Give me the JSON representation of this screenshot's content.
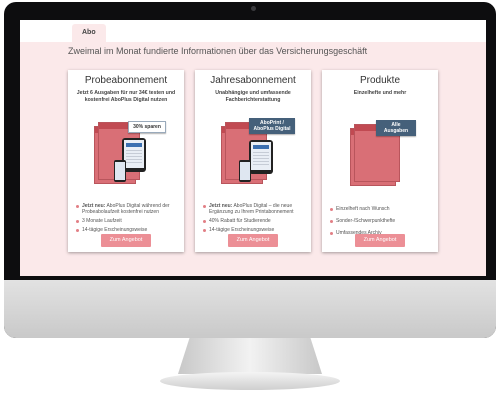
{
  "tab": "Abo",
  "headline": "Zweimal im Monat fundierte Informationen über das Versicherungsgeschäft",
  "cards": [
    {
      "title": "Probeabonnement",
      "subtitle": "Jetzt 6 Ausgaben für nur 34€ testen und kostenfrei AboPlus Digital nutzen",
      "badge": "30% sparen",
      "features": [
        {
          "strong": "Jetzt neu:",
          "text": " AboPlus Digital während der Probeabolaufzeit kostenfrei nutzen"
        },
        {
          "strong": "",
          "text": "3 Monate Laufzeit"
        },
        {
          "strong": "",
          "text": "14-tägige Erscheinungsweise"
        }
      ],
      "button": "Zum Angebot"
    },
    {
      "title": "Jahresabonnement",
      "subtitle": "Unabhängige und umfassende Fachberichterstattung",
      "badge": "AboPrint / AboPlus Digital",
      "features": [
        {
          "strong": "Jetzt neu:",
          "text": " AboPlus Digital – die neue Ergänzung zu Ihrem Printabonnement"
        },
        {
          "strong": "",
          "text": "40% Rabatt für Studierende"
        },
        {
          "strong": "",
          "text": "14-tägige Erscheinungsweise"
        }
      ],
      "button": "Zum Angebot"
    },
    {
      "title": "Produkte",
      "subtitle": "Einzelhefte und mehr",
      "badge": "Alle Ausgaben",
      "features": [
        {
          "strong": "",
          "text": "Einzelheft nach Wunsch"
        },
        {
          "strong": "",
          "text": "Sonder-/Schwerpunkthefte"
        },
        {
          "strong": "",
          "text": "Umfassendes Archiv"
        }
      ],
      "button": "Zum Angebot"
    }
  ]
}
